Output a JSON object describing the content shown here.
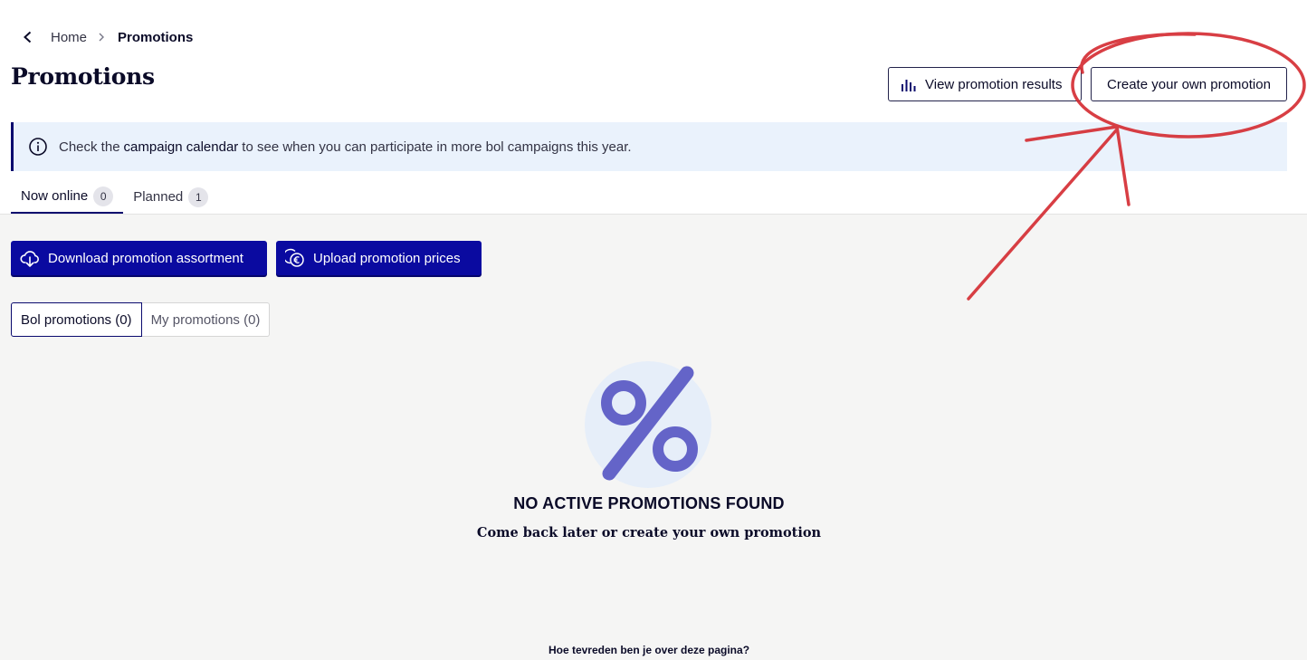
{
  "breadcrumb": {
    "home": "Home",
    "current": "Promotions"
  },
  "header": {
    "title": "Promotions",
    "view_results_label": "View promotion results",
    "create_label": "Create your own promotion"
  },
  "banner": {
    "before": "Check the",
    "link": "campaign calendar",
    "after": "to see when you can participate in more bol campaigns this year."
  },
  "tabs": [
    {
      "label": "Now online",
      "count": "0",
      "active": true
    },
    {
      "label": "Planned",
      "count": "1",
      "active": false
    }
  ],
  "actions": {
    "download_label": "Download promotion assortment",
    "upload_label": "Upload promotion prices"
  },
  "segments": [
    {
      "label": "Bol promotions (0)",
      "active": true
    },
    {
      "label": "My promotions (0)",
      "active": false
    }
  ],
  "empty_state": {
    "icon": "percent-icon",
    "title": "NO ACTIVE PROMOTIONS FOUND",
    "subtitle": "Come back later or create your own promotion"
  },
  "feedback": {
    "question": "Hoe tevreden ben je over deze pagina?"
  },
  "colors": {
    "primary": "#0a0aa0",
    "navy": "#0a0a6e",
    "banner_bg": "#eaf2fc",
    "content_bg": "#f5f5f4",
    "percent": "#6464c8",
    "annotation_red": "#d42a30"
  }
}
